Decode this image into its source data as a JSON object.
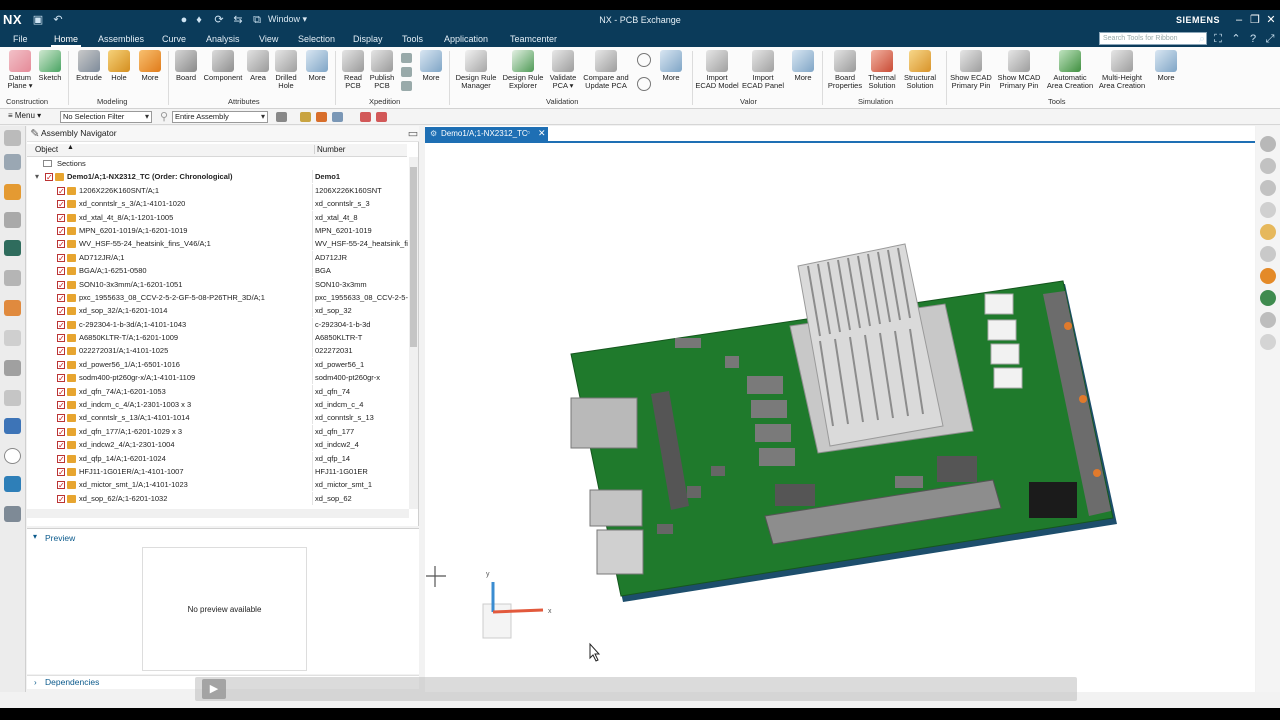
{
  "app": {
    "logo": "NX",
    "title": "NX - PCB Exchange",
    "window_menu": "Window ▾",
    "brand": "SIEMENS",
    "search_placeholder": "Search Tools for Ribbon"
  },
  "menu_tabs": [
    "File",
    "Home",
    "Assemblies",
    "Curve",
    "Analysis",
    "View",
    "Selection",
    "Display",
    "Tools",
    "Application",
    "Teamcenter"
  ],
  "ribbon": {
    "buttons": [
      {
        "label": "Datum\nPlane ▾",
        "icon": "datum-plane-icon"
      },
      {
        "label": "Sketch",
        "icon": "sketch-icon"
      },
      {
        "label": "Extrude",
        "icon": "extrude-icon"
      },
      {
        "label": "Hole",
        "icon": "hole-icon"
      },
      {
        "label": "More",
        "icon": "more-icon"
      },
      {
        "label": "Board",
        "icon": "board-icon"
      },
      {
        "label": "Component",
        "icon": "component-icon"
      },
      {
        "label": "Area",
        "icon": "area-icon"
      },
      {
        "label": "Drilled\nHole",
        "icon": "drilled-hole-icon"
      },
      {
        "label": "More",
        "icon": "more-icon"
      },
      {
        "label": "Read\nPCB",
        "icon": "read-pcb-icon"
      },
      {
        "label": "Publish\nPCB",
        "icon": "publish-pcb-icon"
      },
      {
        "label": "More",
        "icon": "more-icon"
      },
      {
        "label": "Design Rule\nManager",
        "icon": "design-rule-manager-icon"
      },
      {
        "label": "Design Rule\nExplorer",
        "icon": "design-rule-explorer-icon"
      },
      {
        "label": "Validate\nPCA ▾",
        "icon": "validate-pca-icon"
      },
      {
        "label": "Compare and\nUpdate PCA",
        "icon": "compare-update-icon"
      },
      {
        "label": "More",
        "icon": "more-icon"
      },
      {
        "label": "Import\nECAD Model",
        "icon": "import-ecad-model-icon"
      },
      {
        "label": "Import\nECAD Panel",
        "icon": "import-ecad-panel-icon"
      },
      {
        "label": "More",
        "icon": "more-icon"
      },
      {
        "label": "Board\nProperties",
        "icon": "board-properties-icon"
      },
      {
        "label": "Thermal\nSolution",
        "icon": "thermal-solution-icon"
      },
      {
        "label": "Structural\nSolution",
        "icon": "structural-solution-icon"
      },
      {
        "label": "Show ECAD\nPrimary Pin",
        "icon": "show-ecad-pin-icon"
      },
      {
        "label": "Show MCAD\nPrimary Pin",
        "icon": "show-mcad-pin-icon"
      },
      {
        "label": "Automatic\nArea Creation",
        "icon": "auto-area-icon"
      },
      {
        "label": "Multi-Height\nArea Creation",
        "icon": "multi-height-icon"
      },
      {
        "label": "More",
        "icon": "more-icon"
      }
    ],
    "groups": [
      "Construction",
      "Modeling",
      "Attributes",
      "Xpedition",
      "Validation",
      "Valor",
      "Simulation",
      "Tools"
    ]
  },
  "toolbar2": {
    "menu": "≡ Menu ▾",
    "selection_filter": "No Selection Filter",
    "scope": "Entire Assembly"
  },
  "navigator": {
    "title": "Assembly Navigator",
    "col_object": "Object",
    "col_number": "Number",
    "rows": [
      {
        "obj": "Sections",
        "num": "",
        "kind": "folder"
      },
      {
        "obj": "Demo1/A;1-NX2312_TC (Order: Chronological)",
        "num": "Demo1",
        "kind": "root"
      },
      {
        "obj": "1206X226K160SNT/A;1",
        "num": "1206X226K160SNT"
      },
      {
        "obj": "xd_conntslr_s_3/A;1-4101-1020",
        "num": "xd_conntslr_s_3"
      },
      {
        "obj": "xd_xtal_4t_8/A;1-1201-1005",
        "num": "xd_xtal_4t_8"
      },
      {
        "obj": "MPN_6201-1019/A;1-6201-1019",
        "num": "MPN_6201-1019"
      },
      {
        "obj": "WV_HSF-55-24_heatsink_fins_V46/A;1",
        "num": "WV_HSF-55-24_heatsink_fi"
      },
      {
        "obj": "AD712JR/A;1",
        "num": "AD712JR"
      },
      {
        "obj": "BGA/A;1-6251-0580",
        "num": "BGA"
      },
      {
        "obj": "SON10-3x3mm/A;1-6201-1051",
        "num": "SON10-3x3mm"
      },
      {
        "obj": "pxc_1955633_08_CCV-2-5-2-GF-5-08-P26THR_3D/A;1",
        "num": "pxc_1955633_08_CCV-2-5-"
      },
      {
        "obj": "xd_sop_32/A;1-6201-1014",
        "num": "xd_sop_32"
      },
      {
        "obj": "c-292304-1-b-3d/A;1-4101-1043",
        "num": "c-292304-1-b-3d"
      },
      {
        "obj": "A6850KLTR-T/A;1-6201-1009",
        "num": "A6850KLTR-T"
      },
      {
        "obj": "022272031/A;1-4101-1025",
        "num": "022272031"
      },
      {
        "obj": "xd_power56_1/A;1-6501-1016",
        "num": "xd_power56_1"
      },
      {
        "obj": "sodm400-pt260gr-x/A;1-4101-1109",
        "num": "sodm400-pt260gr-x"
      },
      {
        "obj": "xd_qfn_74/A;1-6201-1053",
        "num": "xd_qfn_74"
      },
      {
        "obj": "xd_indcm_c_4/A;1-2301-1003 x 3",
        "num": "xd_indcm_c_4"
      },
      {
        "obj": "xd_conntslr_s_13/A;1-4101-1014",
        "num": "xd_conntslr_s_13"
      },
      {
        "obj": "xd_qfn_177/A;1-6201-1029 x 3",
        "num": "xd_qfn_177"
      },
      {
        "obj": "xd_indcw2_4/A;1-2301-1004",
        "num": "xd_indcw2_4"
      },
      {
        "obj": "xd_qfp_14/A;1-6201-1024",
        "num": "xd_qfp_14"
      },
      {
        "obj": "HFJ11-1G01ER/A;1-4101-1007",
        "num": "HFJ11-1G01ER"
      },
      {
        "obj": "xd_mictor_smt_1/A;1-4101-1023",
        "num": "xd_mictor_smt_1"
      },
      {
        "obj": "xd_sop_62/A;1-6201-1032",
        "num": "xd_sop_62"
      }
    ]
  },
  "preview": {
    "title": "Preview",
    "empty": "No preview available"
  },
  "dependencies": {
    "title": "Dependencies"
  },
  "viewport": {
    "tab": "Demo1/A;1-NX2312_TC",
    "axis_x": "x",
    "axis_y": "y"
  },
  "colors": {
    "brand": "#0b3b5a",
    "accent": "#1e6fb4",
    "pcb": "#1f7a2c"
  }
}
